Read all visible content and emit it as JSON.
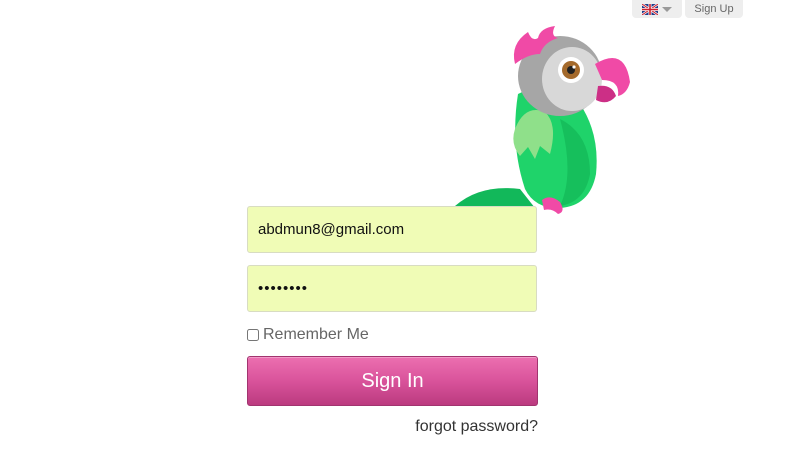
{
  "header": {
    "language_icon": "uk-flag-icon",
    "signup_label": "Sign Up"
  },
  "mascot": {
    "icon": "parrot-mascot"
  },
  "form": {
    "email_value": "abdmun8@gmail.com",
    "password_value": "••••••••",
    "remember_label": "Remember Me",
    "signin_label": "Sign In",
    "forgot_label": "forgot password?"
  },
  "colors": {
    "field_background": "#f0fcb6",
    "button_pink": "#d9539b",
    "parrot_green": "#22d06a",
    "parrot_pink": "#f04aa6"
  }
}
